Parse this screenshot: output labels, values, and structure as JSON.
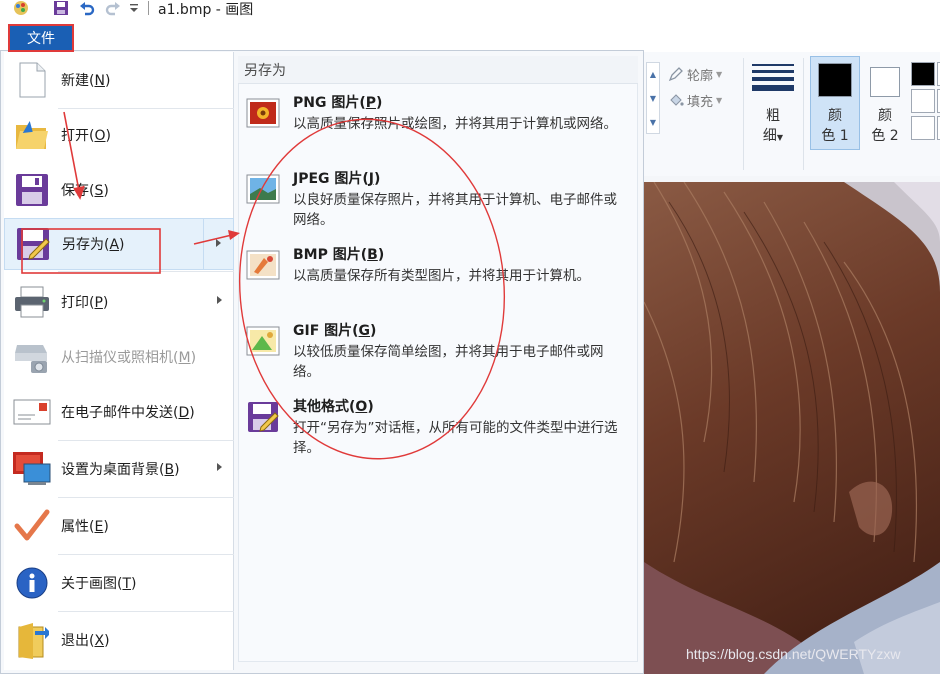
{
  "titlebar": {
    "title": "a1.bmp - 画图",
    "quick_access": [
      "paint-app-icon",
      "save-icon",
      "undo-icon",
      "redo-icon",
      "customize-dropdown-icon"
    ]
  },
  "file_tab": {
    "label": "文件"
  },
  "menu": {
    "items": [
      {
        "name": "menu-new",
        "label": "新建(",
        "key": "N",
        "close": ")",
        "icon": "blank-page-icon",
        "has_submenu": false,
        "enabled": true
      },
      {
        "name": "menu-open",
        "label": "打开(",
        "key": "O",
        "close": ")",
        "icon": "open-folder-icon",
        "has_submenu": false,
        "enabled": true
      },
      {
        "name": "menu-save",
        "label": "保存(",
        "key": "S",
        "close": ")",
        "icon": "floppy-save-icon",
        "has_submenu": false,
        "enabled": true
      },
      {
        "name": "menu-save-as",
        "label": "另存为(",
        "key": "A",
        "close": ")",
        "icon": "save-as-icon",
        "has_submenu": true,
        "enabled": true
      },
      {
        "name": "menu-print",
        "label": "打印(",
        "key": "P",
        "close": ")",
        "icon": "printer-icon",
        "has_submenu": true,
        "enabled": true
      },
      {
        "name": "menu-scanner",
        "label": "从扫描仪或照相机(",
        "key": "M",
        "close": ")",
        "icon": "scanner-camera-icon",
        "has_submenu": false,
        "enabled": false
      },
      {
        "name": "menu-email",
        "label": "在电子邮件中发送(",
        "key": "D",
        "close": ")",
        "icon": "email-envelope-icon",
        "has_submenu": false,
        "enabled": true
      },
      {
        "name": "menu-wallpaper",
        "label": "设置为桌面背景(",
        "key": "B",
        "close": ")",
        "icon": "desktop-monitor-icon",
        "has_submenu": true,
        "enabled": true
      },
      {
        "name": "menu-properties",
        "label": "属性(",
        "key": "E",
        "close": ")",
        "icon": "checkmark-icon",
        "has_submenu": false,
        "enabled": true
      },
      {
        "name": "menu-about",
        "label": "关于画图(",
        "key": "T",
        "close": ")",
        "icon": "info-icon",
        "has_submenu": false,
        "enabled": true
      },
      {
        "name": "menu-exit",
        "label": "退出(",
        "key": "X",
        "close": ")",
        "icon": "exit-door-icon",
        "has_submenu": false,
        "enabled": true
      }
    ]
  },
  "submenu": {
    "header": "另存为",
    "items": [
      {
        "title": "PNG 图片(",
        "key": "P",
        "close": ")",
        "desc": "以高质量保存照片或绘图，并将其用于计算机或网络。",
        "icon": "png-image-icon"
      },
      {
        "title": "JPEG 图片(",
        "key": "J",
        "close": ")",
        "desc": "以良好质量保存照片，并将其用于计算机、电子邮件或网络。",
        "icon": "jpeg-image-icon"
      },
      {
        "title": "BMP 图片(",
        "key": "B",
        "close": ")",
        "desc": "以高质量保存所有类型图片，并将其用于计算机。",
        "icon": "bmp-image-icon"
      },
      {
        "title": "GIF 图片(",
        "key": "G",
        "close": ")",
        "desc": "以较低质量保存简单绘图，并将其用于电子邮件或网络。",
        "icon": "gif-image-icon"
      },
      {
        "title": "其他格式(",
        "key": "O",
        "close": ")",
        "desc": "打开“另存为”对话框，从所有可能的文件类型中进行选择。",
        "icon": "other-format-icon"
      }
    ]
  },
  "ribbon": {
    "outline": "轮廓",
    "fill": "填充",
    "size_top": "粗",
    "size_bottom": "细",
    "color1_top": "颜",
    "color1_bottom": "色 1",
    "color2_top": "颜",
    "color2_bottom": "色 2",
    "color1_value": "#000000",
    "color2_value": "#ffffff"
  },
  "watermark": "https://blog.csdn.net/QWERTYzxw",
  "colors": {
    "file_tab": "#1a5fb4",
    "annotation": "#e03a3a",
    "hover": "#e5f1fb"
  }
}
